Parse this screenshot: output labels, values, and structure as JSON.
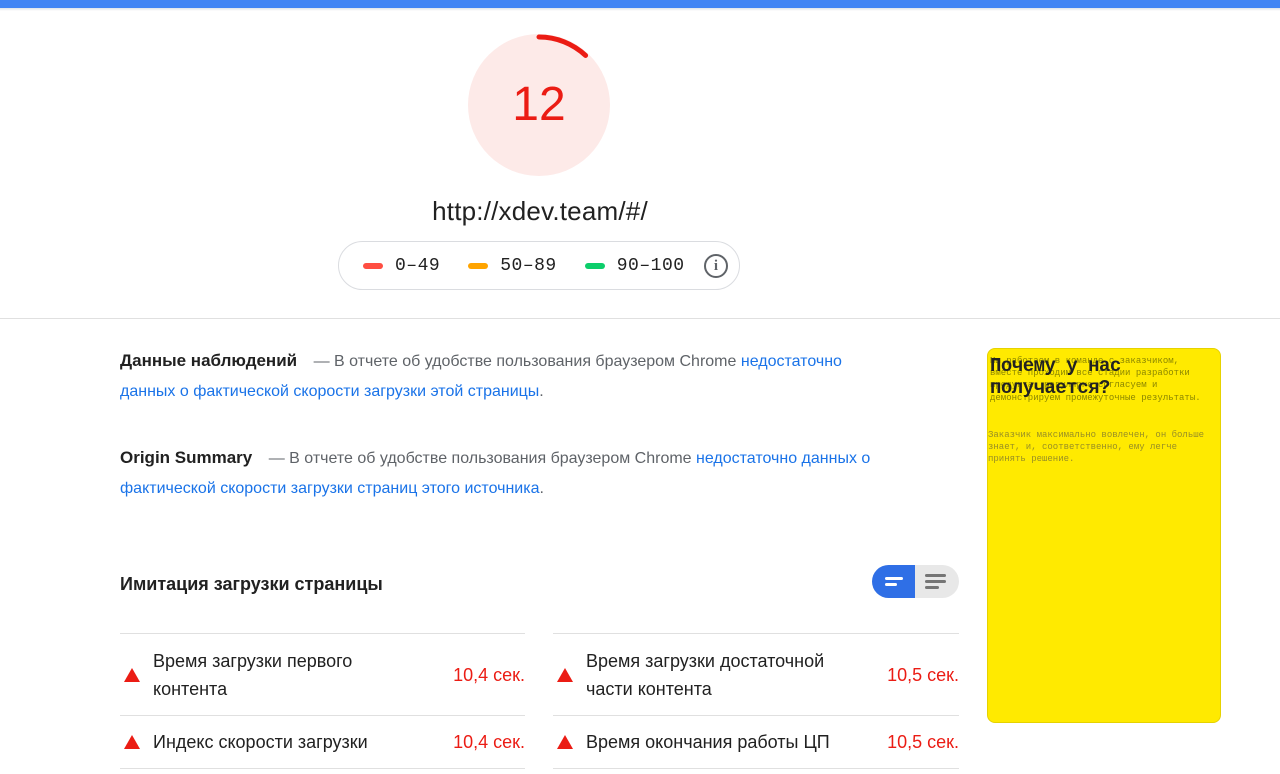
{
  "score": {
    "value": "12",
    "fraction": 0.12,
    "color": "#eb1c14",
    "bg_color": "#fdeae8"
  },
  "url": "http://xdev.team/#/",
  "legend": {
    "items": [
      {
        "range": "0–49",
        "color": "#ff4e42"
      },
      {
        "range": "50–89",
        "color": "#ffa400"
      },
      {
        "range": "90–100",
        "color": "#0cce6b"
      }
    ],
    "info_icon": "info-icon"
  },
  "field_data": {
    "title": "Данные наблюдений",
    "text": "— В отчете об удобстве пользования браузером Chrome",
    "link": "недостаточно данных о фактической скорости загрузки этой страницы",
    "end": "."
  },
  "origin_summary": {
    "title": "Origin Summary",
    "text": "— В отчете об удобстве пользования браузером Chrome",
    "link": "недостаточно данных о фактической скорости загрузки страниц этого источника",
    "end": "."
  },
  "lab": {
    "title": "Имитация загрузки страницы",
    "toggle": {
      "left_icon": "compact-view-icon",
      "right_icon": "list-view-icon",
      "active": "left"
    },
    "metrics": [
      {
        "name": "Время загрузки первого контента",
        "value": "10,4 сек."
      },
      {
        "name": "Время загрузки достаточной части контента",
        "value": "10,5 сек."
      },
      {
        "name": "Индекс скорости загрузки",
        "value": "10,4 сек."
      },
      {
        "name": "Время окончания работы ЦП",
        "value": "10,5 сек."
      }
    ],
    "status_color": "#eb1c14"
  },
  "thumbnail": {
    "heading": "Почему у нас получается?",
    "body_a": "Мы работаем в команде с заказчиком, вместе проходим все стадии разработки продукта, регулярно согласуем и демонстрируем промежуточные результаты.",
    "body_b": "Заказчик максимально вовлечен, он больше знает, и, соответственно, ему легче принять решение.",
    "bg_color": "#ffea00"
  }
}
